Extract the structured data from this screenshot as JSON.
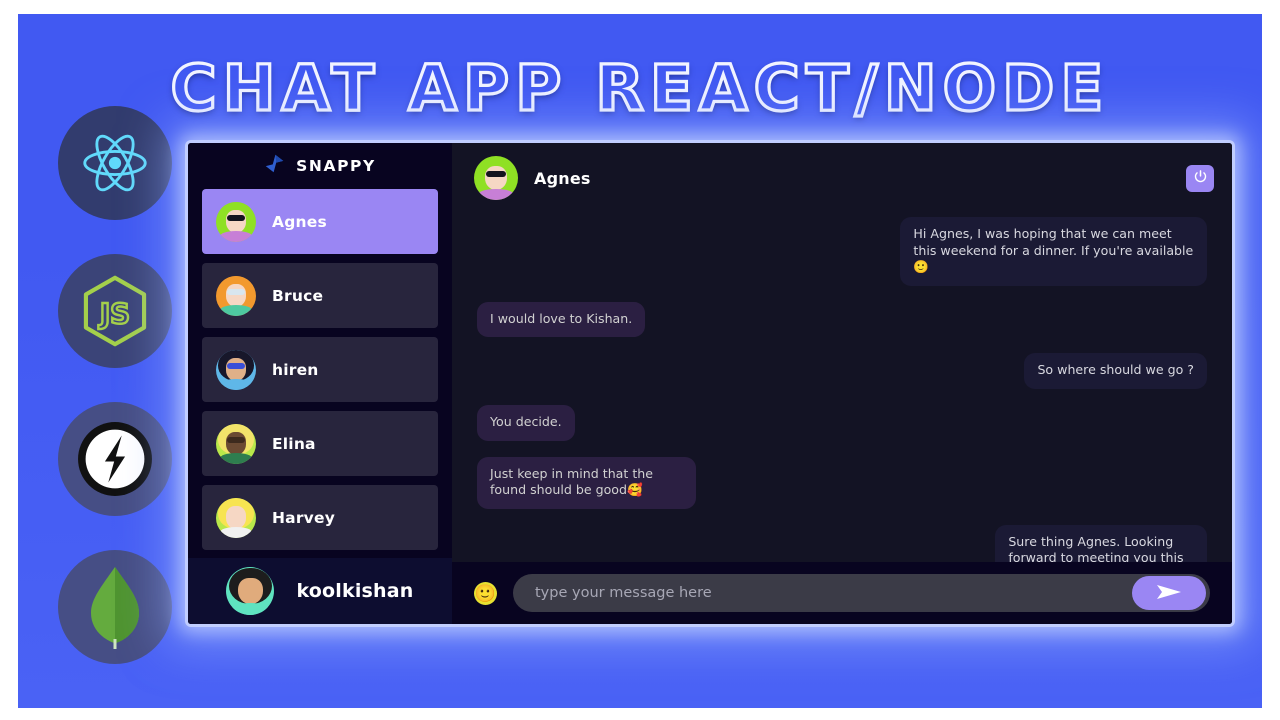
{
  "page": {
    "title": "CHAT APP REACT/NODE",
    "accent_purple": "#9a86f3",
    "stage_blue": "#4159f2",
    "panel_dark": "#131324",
    "sidebar_dark": "#080420"
  },
  "tech_icons": [
    {
      "name": "react-icon",
      "label": "React",
      "color": "#61dafb"
    },
    {
      "name": "nodejs-icon",
      "label": "Node.js",
      "color": "#a4d04b"
    },
    {
      "name": "socketio-icon",
      "label": "Socket.IO",
      "color": "#ffffff"
    },
    {
      "name": "mongodb-icon",
      "label": "MongoDB",
      "color": "#5fa532"
    }
  ],
  "sidebar": {
    "brand": {
      "name": "SNAPPY",
      "logo_icon": "snappy-logo-icon",
      "logo_color": "#2f5fd0"
    },
    "contacts": [
      {
        "name": "Agnes",
        "selected": true,
        "avatar_bg": "#8fe024",
        "hair": "#8fe024",
        "body": "#c77fd6"
      },
      {
        "name": "Bruce",
        "selected": false,
        "avatar_bg": "#f2992e",
        "hair": "#f2992e",
        "body": "#4ec9a0"
      },
      {
        "name": "hiren",
        "selected": false,
        "avatar_bg": "#1d1f3a",
        "hair": "#17172a",
        "body": "#5fb7e8"
      },
      {
        "name": "Elina",
        "selected": false,
        "avatar_bg": "#b9e84a",
        "hair": "#f2e36a",
        "body": "#2e7d4f"
      },
      {
        "name": "Harvey",
        "selected": false,
        "avatar_bg": "#b9e84a",
        "hair": "#f7e451",
        "body": "#f1f1f1"
      }
    ],
    "current_user": {
      "name": "koolkishan",
      "avatar_bg": "#5fe3c0",
      "hair": "#1d1d1d",
      "body": "#5fe3c0"
    }
  },
  "chat": {
    "header": {
      "contact_name": "Agnes",
      "avatar_bg": "#8fe024",
      "logout_icon": "power-icon",
      "logout_label": "Logout"
    },
    "messages": [
      {
        "from": "sent",
        "text": "Hi Agnes, I was hoping that we can meet this weekend for a dinner. If you're available 🙂"
      },
      {
        "from": "received",
        "text": "I would love to Kishan."
      },
      {
        "from": "sent",
        "text": "So where should we go ?"
      },
      {
        "from": "received",
        "text": "You decide."
      },
      {
        "from": "received",
        "text": "Just keep in mind that the found should be good🥰"
      },
      {
        "from": "sent",
        "text": "Sure thing Agnes. Looking forward to meeting you this weekend.😍😍"
      }
    ],
    "input": {
      "value": "",
      "placeholder": "type your message here",
      "emoji_icon": "🙂",
      "emoji_label": "Emoji picker",
      "send_icon": "send-arrow-icon",
      "send_label": "Send"
    }
  }
}
